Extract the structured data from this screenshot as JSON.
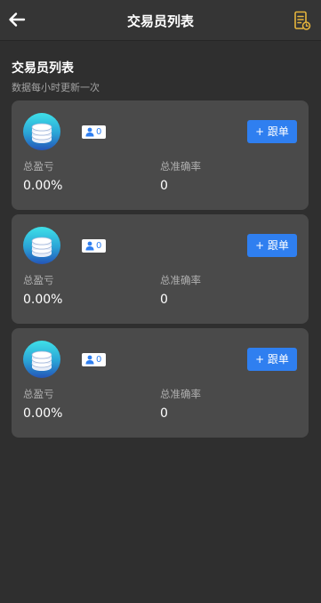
{
  "header": {
    "title": "交易员列表",
    "back_icon": "arrow-left-icon",
    "record_icon": "document-clock-icon"
  },
  "section": {
    "title": "交易员列表",
    "subtitle": "数据每小时更新一次"
  },
  "colors": {
    "background": "#2f2f2f",
    "card": "#4a4a4a",
    "accent": "#2f7ff0"
  },
  "traders": [
    {
      "avatar_icon": "coin-stack-icon",
      "follower_count": "0",
      "follow_label": "+ 跟单",
      "profit_label": "总盈亏",
      "profit_value": "0.00%",
      "accuracy_label": "总准确率",
      "accuracy_value": "0"
    },
    {
      "avatar_icon": "coin-stack-icon",
      "follower_count": "0",
      "follow_label": "+ 跟单",
      "profit_label": "总盈亏",
      "profit_value": "0.00%",
      "accuracy_label": "总准确率",
      "accuracy_value": "0"
    },
    {
      "avatar_icon": "coin-stack-icon",
      "follower_count": "0",
      "follow_label": "+ 跟单",
      "profit_label": "总盈亏",
      "profit_value": "0.00%",
      "accuracy_label": "总准确率",
      "accuracy_value": "0"
    }
  ]
}
